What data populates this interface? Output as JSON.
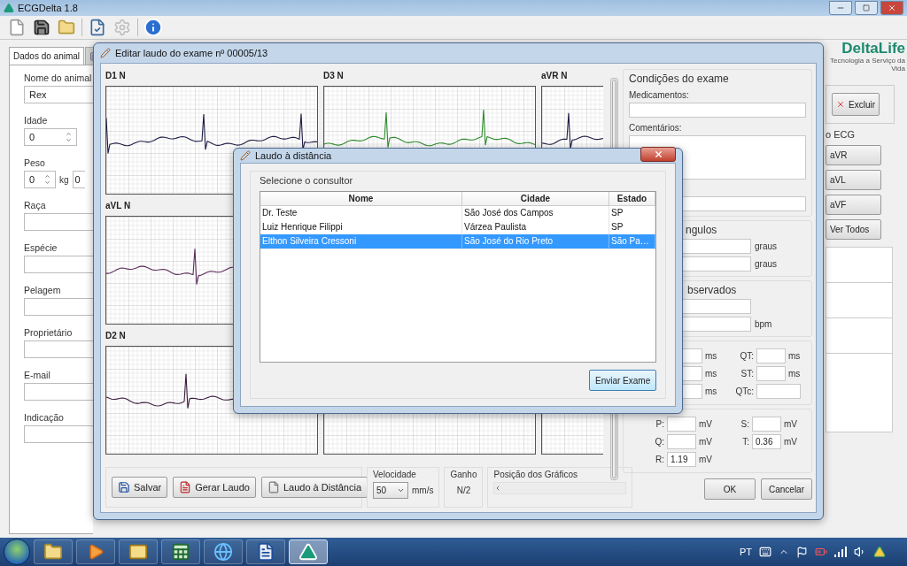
{
  "app": {
    "title": "ECGDelta 1.8"
  },
  "toolbar": [
    {
      "kind": "new",
      "disabled": false
    },
    {
      "kind": "save",
      "disabled": false
    },
    {
      "kind": "open",
      "disabled": false
    },
    {
      "kind": "separator"
    },
    {
      "kind": "report",
      "disabled": false
    },
    {
      "kind": "settings",
      "disabled": true
    },
    {
      "kind": "separator"
    },
    {
      "kind": "info",
      "disabled": false
    }
  ],
  "animal": {
    "tabs": [
      {
        "kind": "text",
        "label": "Dados do animal",
        "selected": true
      },
      {
        "kind": "icon",
        "selected": false
      }
    ],
    "fields": [
      {
        "kind": "text",
        "label": "Nome do animal",
        "value": "Rex"
      },
      {
        "kind": "spin",
        "label": "Idade",
        "value": "0"
      },
      {
        "kind": "spin",
        "label": "Peso",
        "value": "0",
        "unit": "kg",
        "extra": "0"
      },
      {
        "kind": "text",
        "label": "Raça"
      },
      {
        "kind": "text",
        "label": "Espécie"
      },
      {
        "kind": "text",
        "label": "Pelagem"
      },
      {
        "kind": "text",
        "label": "Proprietário"
      },
      {
        "kind": "text",
        "label": "E-mail"
      },
      {
        "kind": "text",
        "label": "Indicação"
      }
    ]
  },
  "brand": {
    "name": "DeltaLife",
    "tagline": "Tecnologia a Serviço da Vida"
  },
  "side": {
    "delete": "Excluir",
    "ecg_group": "o ECG",
    "leads": [
      "aVR",
      "aVL",
      "aVF",
      "Ver Todos"
    ]
  },
  "editor": {
    "title": "Editar laudo do exame nº 00005/13",
    "lead_rows": [
      [
        {
          "label": "D1 N",
          "color": "#1c1c44"
        },
        {
          "label": "D3 N",
          "color": "#2e8b2e"
        },
        {
          "label": "aVR N",
          "color": "#1c1c44"
        }
      ],
      [
        {
          "label": "aVL N",
          "color": "#5a2a5a"
        }
      ],
      [
        {
          "label": "D2 N",
          "color": "#3a1a3a"
        }
      ]
    ],
    "actions": [
      {
        "kind": "save",
        "label": "Salvar"
      },
      {
        "kind": "pdf",
        "label": "Gerar Laudo"
      },
      {
        "kind": "remote",
        "label": "Laudo à Distância"
      }
    ],
    "speed": {
      "label": "Velocidade",
      "value": "50",
      "unit": "mm/s"
    },
    "gain": {
      "label": "Ganho",
      "value": "N/2"
    },
    "position": {
      "label": "Posição dos Gráficos"
    },
    "conditions": {
      "title": "Condições do exame",
      "meds_label": "Medicamentos:",
      "comments_label": "Comentários:"
    },
    "angles": {
      "title": "ngulos",
      "units": [
        "graus",
        "graus"
      ]
    },
    "observed": {
      "title": "bservados",
      "unit": "bpm"
    },
    "intervals": [
      {
        "unit": "ms",
        "label": "QT:",
        "unit2": "ms"
      },
      {
        "unit": "ms",
        "label": "ST:",
        "unit2": "ms"
      },
      {
        "unit": "ms",
        "label": "QTc:"
      }
    ],
    "amplitudes": [
      [
        {
          "label": "P:",
          "unit": "mV"
        },
        {
          "label": "S:",
          "unit": "mV"
        }
      ],
      [
        {
          "label": "Q:",
          "unit": "mV"
        },
        {
          "label": "T:",
          "value": "0.36",
          "unit": "mV"
        }
      ],
      [
        {
          "label": "R:",
          "value": "1.19",
          "unit": "mV"
        }
      ]
    ],
    "buttons": [
      "OK",
      "Cancelar"
    ]
  },
  "dialog": {
    "title": "Laudo à distância",
    "group": "Selecione o consultor",
    "columns": [
      "Nome",
      "Cidade",
      "Estado"
    ],
    "rows": [
      {
        "cells": [
          "Dr. Teste",
          "São José dos Campos",
          "SP"
        ],
        "selected": false
      },
      {
        "cells": [
          "Luiz Henrique Filippi",
          "Várzea Paulista",
          "SP"
        ],
        "selected": false
      },
      {
        "cells": [
          "Elthon Silveira Cressoni",
          "São José do Rio Preto",
          "São Pa…"
        ],
        "selected": true
      }
    ],
    "button": "Enviar Exame"
  },
  "taskbar": {
    "apps": [
      {
        "kind": "explorer",
        "active": false
      },
      {
        "kind": "media",
        "active": false
      },
      {
        "kind": "mail",
        "active": false
      },
      {
        "kind": "sheet",
        "active": false
      },
      {
        "kind": "browser",
        "active": false
      },
      {
        "kind": "word",
        "active": false
      },
      {
        "kind": "ecg",
        "active": true
      }
    ],
    "language": "PT"
  }
}
